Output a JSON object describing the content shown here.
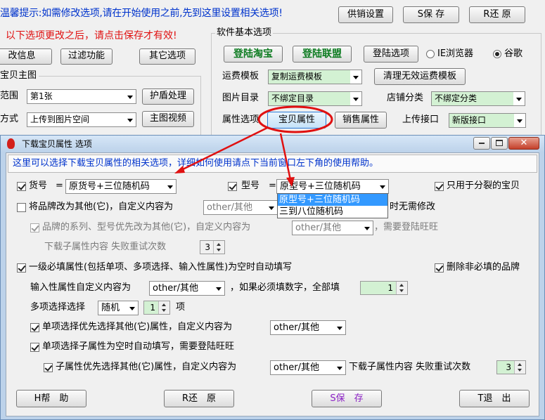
{
  "main": {
    "hint_top": "温馨提示:如需修改选项,请在开始使用之前,先到这里设置相关选项!",
    "hint_red": "以下选项更改之后，请点击保存才有效!",
    "btn_supply": "供销设置",
    "btn_save": "S保 存",
    "btn_restore": "R还 原",
    "btn_info": "改信息",
    "btn_filter": "过滤功能",
    "btn_other": "其它选项",
    "group_main_image": "宝贝主图",
    "label_range": "范围",
    "combo_range": "第1张",
    "btn_shield": "护盾处理",
    "label_method": "方式",
    "combo_method": "上传到图片空间",
    "btn_video": "主图视频",
    "group_basic": "软件基本选项",
    "btn_login_taobao": "登陆淘宝",
    "btn_login_alliance": "登陆联盟",
    "btn_login_options": "登陆选项",
    "radio_ie": "IE浏览器",
    "radio_google": "谷歌",
    "label_freight": "运费模板",
    "combo_freight": "复制运费模板",
    "btn_clear_freight": "清理无效运费模板",
    "label_img_dir": "图片目录",
    "combo_img_dir": "不绑定目录",
    "label_shop_cat": "店铺分类",
    "combo_shop_cat": "不绑定分类",
    "label_attr_opts": "属性选项",
    "btn_item_attr": "宝贝属性",
    "btn_sale_attr": "销售属性",
    "label_upload_api": "上传接口",
    "combo_upload_api": "新版接口"
  },
  "dialog": {
    "title": "下载宝贝属性 选项",
    "info": "这里可以选择下载宝贝属性的相关选项，详细如何使用请点下当前窗口左下角的使用帮助。",
    "chk_huohao": "货号",
    "eq1": "=",
    "combo_huohao": "原货号+三位随机码",
    "chk_xinghao": "型号",
    "eq2": "=",
    "combo_xinghao": "原型号+三位随机码",
    "dropdown_options": [
      "原型号+三位随机码",
      "三到八位随机码"
    ],
    "chk_split_only": "只用于分裂的宝贝",
    "chk_brand_change": "将品牌改为其他(它)，自定义内容为",
    "combo_brand_other": "other/其他",
    "brand_suffix": "时无需修改",
    "chk_series": "品牌的系列、型号优先改为其他(它)，自定义内容为",
    "combo_series_other": "other/其他",
    "series_suffix": "，需要登陆旺旺",
    "label_retry_sub": "下载子属性内容  失败重试次数",
    "spin_retry_sub": "3",
    "chk_autofill": "一级必填属性(包括单项、多项选择、输入性属性)为空时自动填写",
    "chk_delete_brand": "删除非必填的品牌",
    "label_input_custom": "输入性属性自定义内容为",
    "combo_input_custom": "other/其他",
    "label_if_number": "，如果必须填数字，全部填",
    "spin_number": "1",
    "label_multi_select": "多项选择选择",
    "combo_multi": "随机",
    "spin_multi": "1",
    "label_item": "项",
    "chk_single_other": "单项选择优先选择其他(它)属性，自定义内容为",
    "combo_single_other": "other/其他",
    "chk_single_sub": "单项选择子属性为空时自动填写，需要登陆旺旺",
    "chk_sub_other": "子属性优先选择其他(它)属性，自定义内容为",
    "combo_sub_other": "other/其他",
    "label_retry2": "下载子属性内容  失败重试次数",
    "spin_retry2": "3",
    "btn_help": "H帮　助",
    "btn_restore": "R还　原",
    "btn_save": "S保　存",
    "btn_exit": "T退　出"
  },
  "colors": {
    "accent_blue": "#0033cc",
    "red": "#e01010",
    "green_field": "#d3f1d3",
    "highlight": "#3399ff"
  }
}
